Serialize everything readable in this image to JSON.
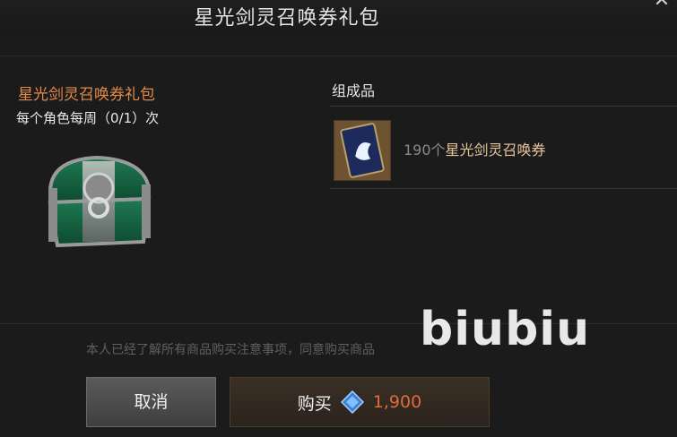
{
  "window": {
    "title": "星光剑灵召唤券礼包"
  },
  "package": {
    "name": "星光剑灵召唤券礼包",
    "limit": "每个角色每周（0/1）次"
  },
  "contents": {
    "title": "组成品",
    "items": [
      {
        "quantity": "190个",
        "name": "星光剑灵召唤券",
        "icon": "summon-ticket-card"
      }
    ]
  },
  "consent_text": "本人已经了解所有商品购买注意事项，同意购买商品",
  "buttons": {
    "cancel": "取消",
    "buy": "购买",
    "price": "1,900",
    "currency_icon": "blue-gem"
  },
  "watermark": "biubiu",
  "colors": {
    "package_name": "#e28a4a",
    "item_name": "#e7c69a",
    "price": "#e06b3c"
  }
}
